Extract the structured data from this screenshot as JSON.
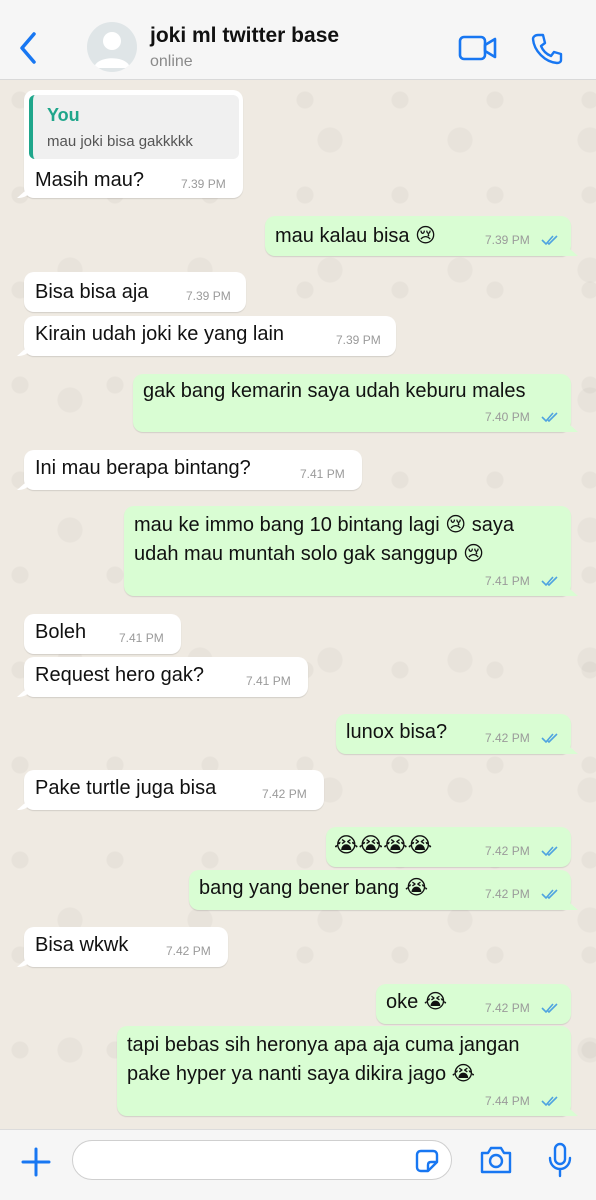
{
  "header": {
    "back_icon": "chevron-left-icon",
    "contact_name": "joki ml twitter base",
    "status": "online",
    "video_icon": "video-camera-icon",
    "call_icon": "phone-icon",
    "accent_color": "#1877f2"
  },
  "messages": [
    {
      "dir": "in",
      "quote_author": "You",
      "quote_text": "mau joki bisa gakkkkk",
      "text": "Masih mau?",
      "time": "7.39 PM"
    },
    {
      "dir": "out",
      "text": "mau kalau bisa 😢",
      "time": "7.39 PM",
      "read": true
    },
    {
      "dir": "in",
      "text": "Bisa bisa aja",
      "time": "7.39 PM"
    },
    {
      "dir": "in",
      "text": "Kirain udah joki ke yang lain",
      "time": "7.39 PM"
    },
    {
      "dir": "out",
      "text": "gak bang kemarin saya udah keburu males",
      "time": "7.40 PM",
      "read": true
    },
    {
      "dir": "in",
      "text": "Ini mau berapa bintang?",
      "time": "7.41 PM"
    },
    {
      "dir": "out",
      "lines": [
        "mau ke immo bang 10 bintang lagi 😢 saya",
        "udah mau muntah solo gak sanggup 😢"
      ],
      "time": "7.41 PM",
      "read": true
    },
    {
      "dir": "in",
      "text": "Boleh",
      "time": "7.41 PM"
    },
    {
      "dir": "in",
      "text": "Request hero gak?",
      "time": "7.41 PM"
    },
    {
      "dir": "out",
      "text": "lunox bisa?",
      "time": "7.42 PM",
      "read": true
    },
    {
      "dir": "in",
      "text": "Pake turtle juga bisa",
      "time": "7.42 PM"
    },
    {
      "dir": "out",
      "text": "😭😭😭😭",
      "time": "7.42 PM",
      "read": true
    },
    {
      "dir": "out",
      "text": "bang yang bener bang 😭",
      "time": "7.42 PM",
      "read": true
    },
    {
      "dir": "in",
      "text": "Bisa wkwk",
      "time": "7.42 PM"
    },
    {
      "dir": "out",
      "text": "oke 😭",
      "time": "7.42 PM",
      "read": true
    },
    {
      "dir": "out",
      "lines": [
        "tapi bebas sih heronya apa aja cuma jangan",
        "pake hyper ya nanti saya dikira jago 😭"
      ],
      "time": "7.44 PM",
      "read": true
    }
  ],
  "colors": {
    "incoming_bubble": "#ffffff",
    "outgoing_bubble": "#d9fdd3",
    "read_ticks": "#4fa3e0",
    "quote_accent": "#1fa68b"
  },
  "input_bar": {
    "plus_icon": "plus-icon",
    "placeholder": "",
    "sticker_icon": "sticker-icon",
    "camera_icon": "camera-icon",
    "mic_icon": "microphone-icon"
  }
}
